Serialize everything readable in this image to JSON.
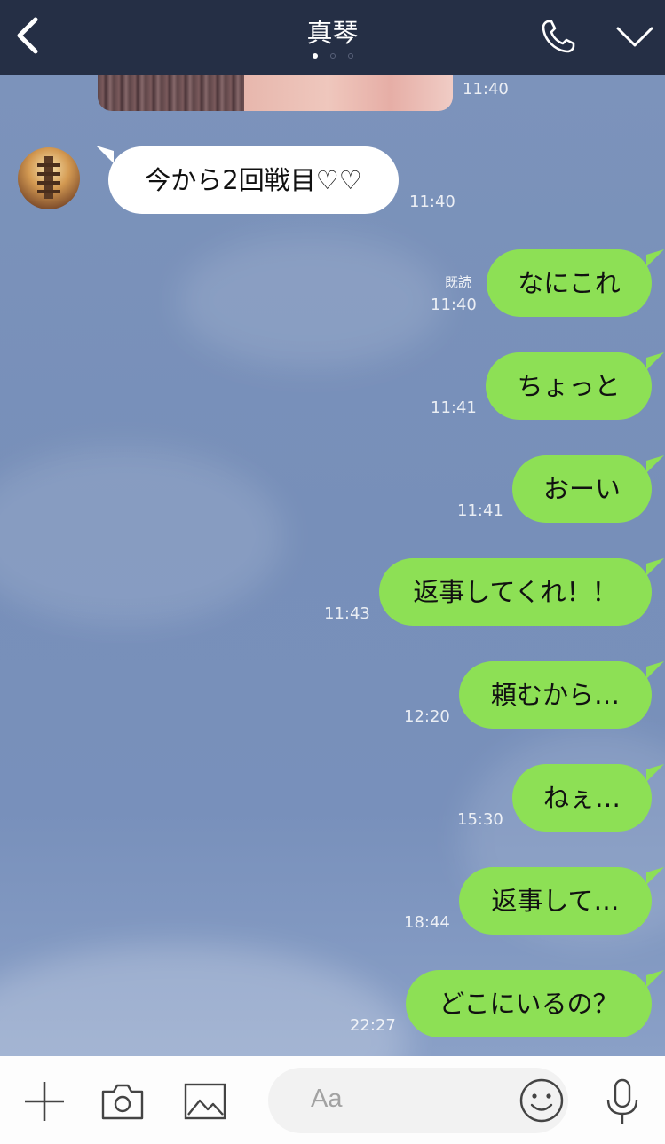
{
  "header": {
    "title": "真琴",
    "icons": [
      "back-chevron-icon",
      "phone-icon",
      "chevron-down-icon"
    ]
  },
  "messages": [
    {
      "from": "them-image",
      "time": "11:40"
    },
    {
      "from": "them",
      "text": "今から2回戦目♡♡",
      "time": "11:40"
    },
    {
      "from": "me",
      "text": "なにこれ",
      "time": "11:40",
      "read": "既読"
    },
    {
      "from": "me",
      "text": "ちょっと",
      "time": "11:41"
    },
    {
      "from": "me",
      "text": "おーい",
      "time": "11:41"
    },
    {
      "from": "me",
      "text": "返事してくれ！！",
      "time": "11:43"
    },
    {
      "from": "me",
      "text": "頼むから…",
      "time": "12:20"
    },
    {
      "from": "me",
      "text": "ねぇ…",
      "time": "15:30"
    },
    {
      "from": "me",
      "text": "返事して…",
      "time": "18:44"
    },
    {
      "from": "me",
      "text": "どこにいるの？",
      "time": "22:27"
    }
  ],
  "input": {
    "placeholder": "Aa",
    "icons": [
      "plus-icon",
      "camera-icon",
      "image-icon",
      "emoji-icon",
      "microphone-icon"
    ]
  },
  "colors": {
    "header_bg": "#252f45",
    "chat_bg": "#7a91bb",
    "outgoing_bubble": "#8de055",
    "incoming_bubble": "#ffffff"
  }
}
